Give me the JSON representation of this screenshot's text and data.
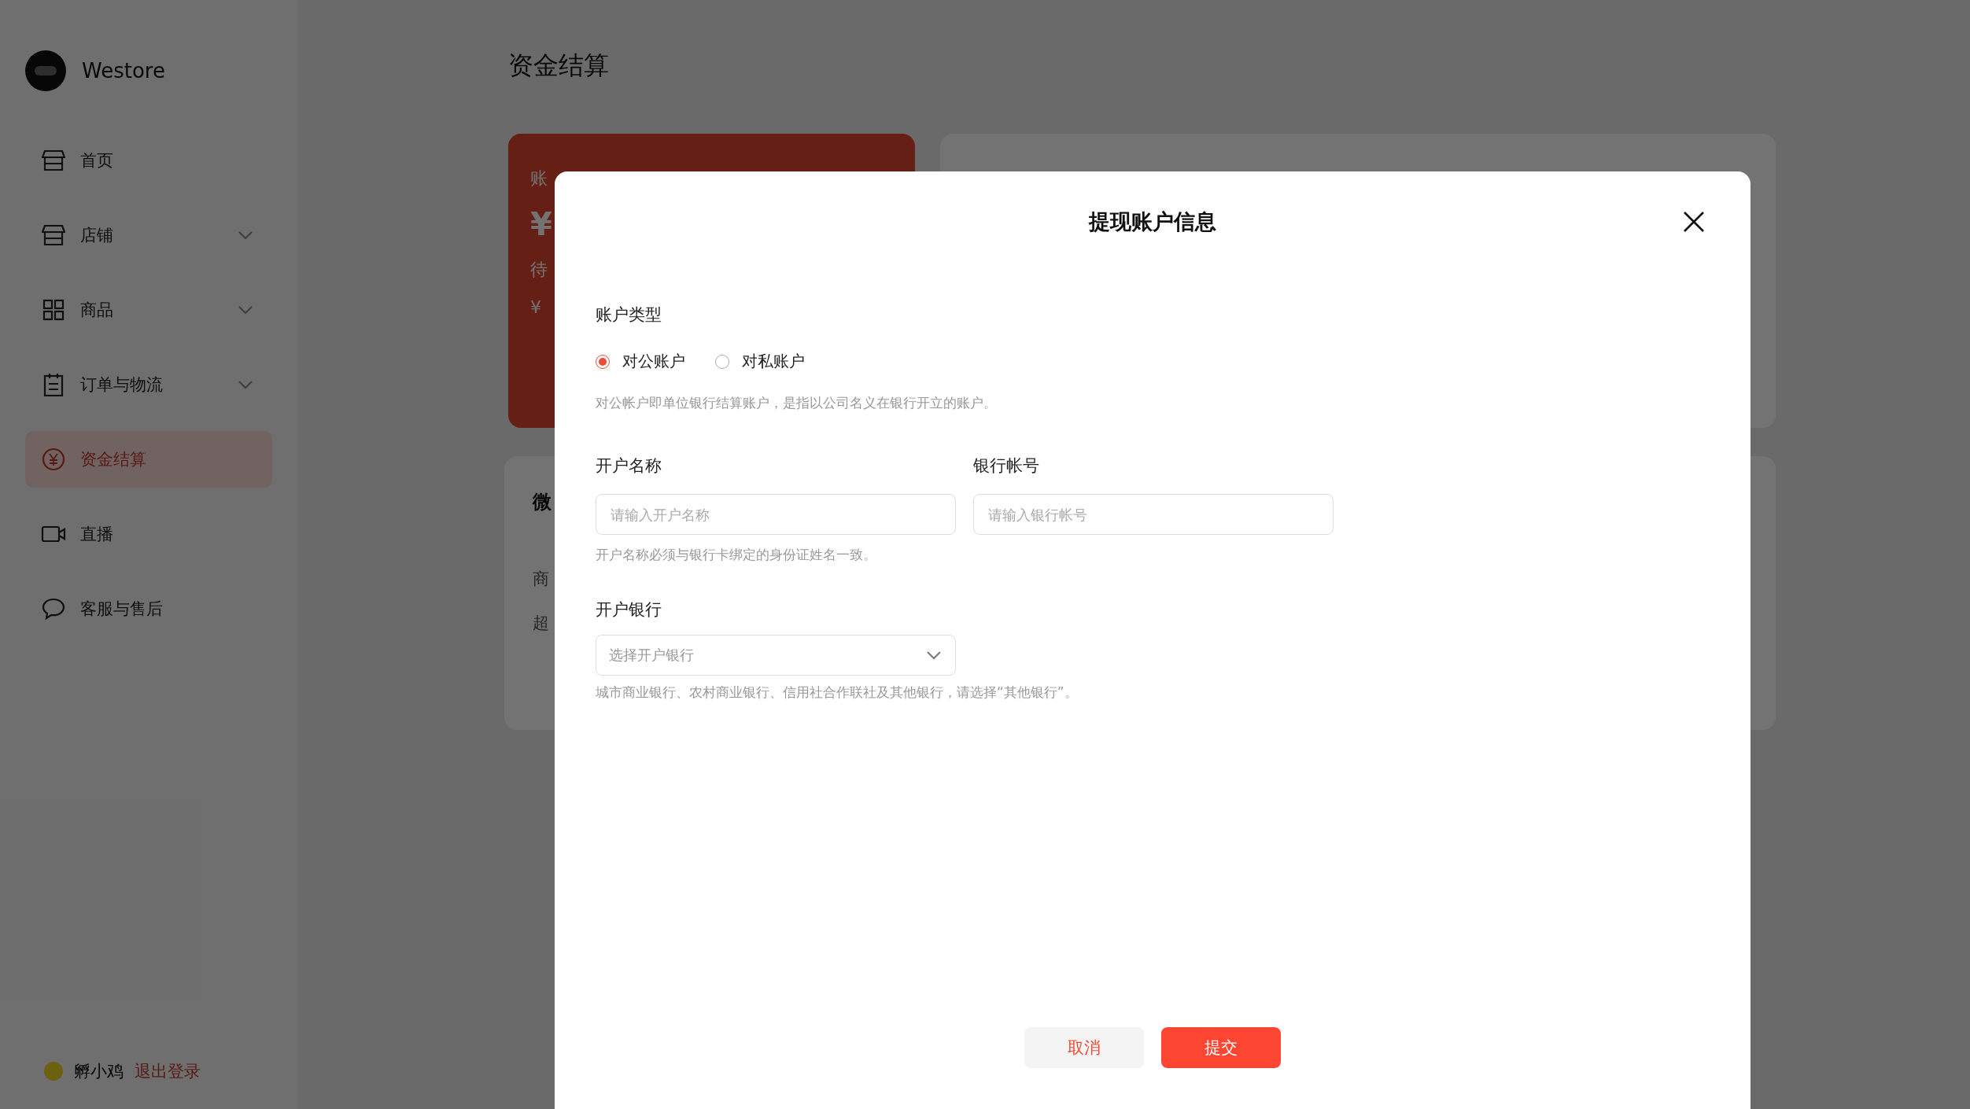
{
  "sidebar": {
    "brand": "Westore",
    "items": [
      {
        "label": "首页",
        "kind": "store",
        "expandable": false,
        "selected": false
      },
      {
        "label": "店铺",
        "kind": "store",
        "expandable": true,
        "selected": false
      },
      {
        "label": "商品",
        "kind": "grid",
        "expandable": true,
        "selected": false
      },
      {
        "label": "订单与物流",
        "kind": "clipboard",
        "expandable": true,
        "selected": false
      },
      {
        "label": "资金结算",
        "kind": "yen",
        "expandable": false,
        "selected": true
      },
      {
        "label": "直播",
        "kind": "video",
        "expandable": false,
        "selected": false
      },
      {
        "label": "客服与售后",
        "kind": "chat",
        "expandable": false,
        "selected": false
      }
    ],
    "user": {
      "name": "孵小鸡",
      "logout": "退出登录"
    }
  },
  "page": {
    "title": "资金结算",
    "balance_card": {
      "label": "账",
      "amount": "¥",
      "pending_label": "待",
      "pending_amount": "¥"
    },
    "wechat_card": {
      "title": "微",
      "line_1": "商",
      "line_2": "超"
    }
  },
  "modal": {
    "title": "提现账户信息",
    "account_type": {
      "label": "账户类型",
      "options": [
        {
          "label": "对公账户",
          "selected": true
        },
        {
          "label": "对私账户",
          "selected": false
        }
      ],
      "hint": "对公帐户即单位银行结算账户，是指以公司名义在银行开立的账户。"
    },
    "fields": [
      {
        "label": "开户名称",
        "placeholder": "请输入开户名称"
      },
      {
        "label": "银行帐号",
        "placeholder": "请输入银行帐号"
      }
    ],
    "fields_hint": "开户名称必须与银行卡绑定的身份证姓名一致。",
    "bank": {
      "label": "开户银行",
      "placeholder": "选择开户银行",
      "hint": "城市商业银行、农村商业银行、信用社合作联社及其他银行，请选择“其他银行”。"
    },
    "buttons": [
      {
        "label": "取消",
        "kind": "secondary"
      },
      {
        "label": "提交",
        "kind": "primary"
      }
    ]
  }
}
